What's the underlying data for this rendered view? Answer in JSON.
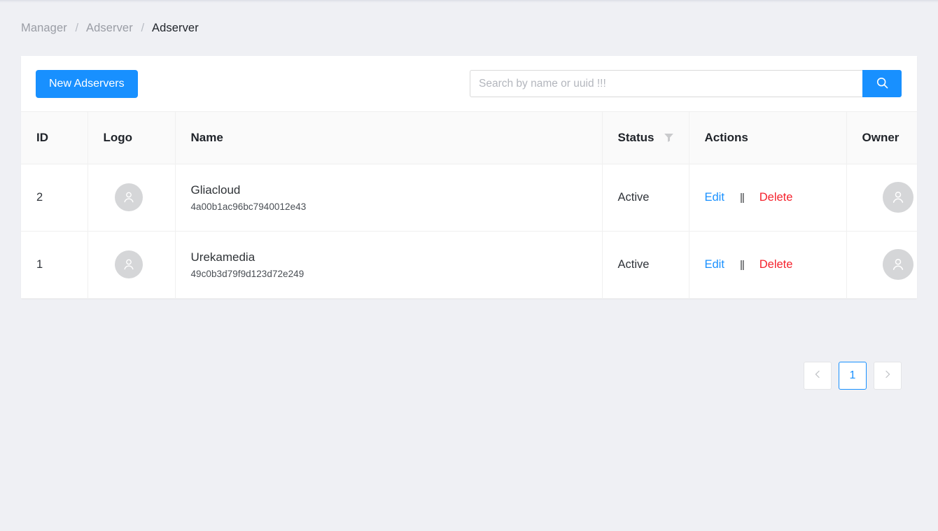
{
  "breadcrumb": {
    "items": [
      {
        "label": "Manager",
        "current": false
      },
      {
        "label": "Adserver",
        "current": false
      },
      {
        "label": "Adserver",
        "current": true
      }
    ],
    "separator": "/"
  },
  "toolbar": {
    "new_button_label": "New Adservers",
    "search_placeholder": "Search by name or uuid !!!",
    "search_value": "",
    "search_icon": "search-icon"
  },
  "table": {
    "columns": [
      {
        "key": "id",
        "label": "ID"
      },
      {
        "key": "logo",
        "label": "Logo"
      },
      {
        "key": "name",
        "label": "Name"
      },
      {
        "key": "status",
        "label": "Status",
        "filter_icon": "filter-icon"
      },
      {
        "key": "actions",
        "label": "Actions"
      },
      {
        "key": "owner",
        "label": "Owner"
      }
    ],
    "rows": [
      {
        "id": "2",
        "logo_icon": "user-avatar-icon",
        "name": "Gliacloud",
        "uuid": "4a00b1ac96bc7940012e43",
        "status": "Active",
        "edit_label": "Edit",
        "separator": "||",
        "delete_label": "Delete",
        "owner_icon": "user-avatar-icon"
      },
      {
        "id": "1",
        "logo_icon": "user-avatar-icon",
        "name": "Urekamedia",
        "uuid": "49c0b3d79f9d123d72e249",
        "status": "Active",
        "edit_label": "Edit",
        "separator": "||",
        "delete_label": "Delete",
        "owner_icon": "user-avatar-icon"
      }
    ]
  },
  "pagination": {
    "prev_icon": "chevron-left-icon",
    "next_icon": "chevron-right-icon",
    "pages": [
      {
        "label": "1",
        "active": true
      }
    ]
  },
  "colors": {
    "accent": "#1890ff",
    "danger": "#f5222d",
    "background": "#eff0f4",
    "surface": "#ffffff",
    "border": "#f0f0f0",
    "header_bg": "#fafafa"
  }
}
